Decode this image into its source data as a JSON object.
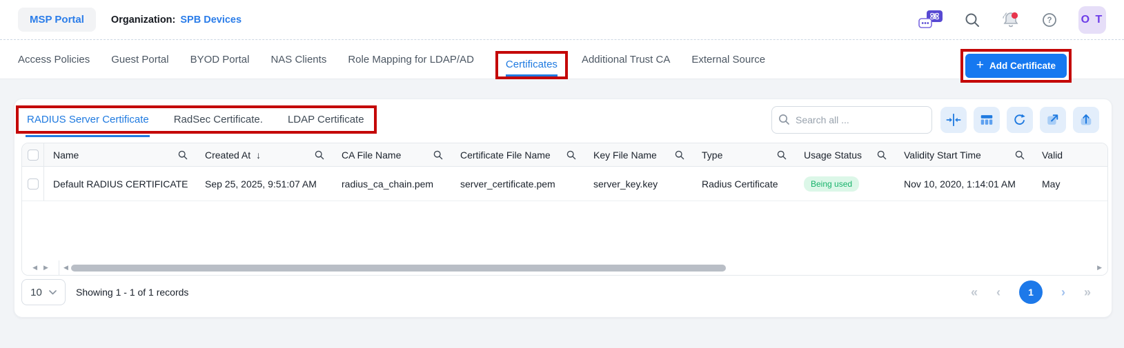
{
  "header": {
    "portal_button": "MSP Portal",
    "organization_label": "Organization:",
    "organization_name": "SPB Devices",
    "avatar_initials": "O T"
  },
  "tab_bar": {
    "tabs": [
      "Access Policies",
      "Guest Portal",
      "BYOD Portal",
      "NAS Clients",
      "Role Mapping for LDAP/AD",
      "Certificates",
      "Additional Trust CA",
      "External Source"
    ],
    "active_tab": "Certificates",
    "add_certificate_label": "Add Certificate"
  },
  "certificate_tabs": {
    "tabs": [
      "RADIUS Server Certificate",
      "RadSec Certificate.",
      "LDAP Certificate"
    ],
    "active_tab": "RADIUS Server Certificate"
  },
  "search": {
    "placeholder": "Search all ..."
  },
  "toolbar": {
    "icons": [
      "fit-columns-icon",
      "columns-icon",
      "refresh-icon",
      "export-icon",
      "upload-icon"
    ]
  },
  "table": {
    "columns": [
      {
        "label": "Name"
      },
      {
        "label": "Created At",
        "sort": "desc"
      },
      {
        "label": "CA File Name"
      },
      {
        "label": "Certificate File Name"
      },
      {
        "label": "Key File Name"
      },
      {
        "label": "Type"
      },
      {
        "label": "Usage Status"
      },
      {
        "label": "Validity Start Time"
      },
      {
        "label": "Valid"
      }
    ],
    "rows": [
      {
        "name": "Default RADIUS CERTIFICATE",
        "created_at": "Sep 25, 2025, 9:51:07 AM",
        "ca_file_name": "radius_ca_chain.pem",
        "certificate_file_name": "server_certificate.pem",
        "key_file_name": "server_key.key",
        "type": "Radius Certificate",
        "usage_status": "Being used",
        "validity_start_time": "Nov 10, 2020, 1:14:01 AM",
        "validity_end_time": "May"
      }
    ]
  },
  "pagination": {
    "page_size": "10",
    "summary": "Showing 1 - 1 of 1 records",
    "current_page": "1"
  },
  "icons": {
    "plus": "+",
    "sort_desc": "↓",
    "scroll_left": "◀",
    "scroll_right": "▶",
    "page_first": "«",
    "page_prev": "‹",
    "page_next": "›",
    "page_last": "»"
  },
  "colors": {
    "accent_blue": "#1f7ae0",
    "button_blue": "#1678f0",
    "annotation_red": "#c40606",
    "status_green": "#17b26a",
    "status_green_bg": "#dcf7e8"
  }
}
